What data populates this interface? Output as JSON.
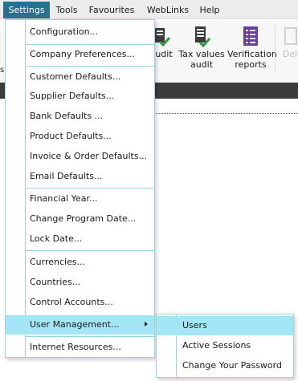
{
  "menubar": {
    "items": [
      {
        "label": "Settings",
        "active": true
      },
      {
        "label": "Tools"
      },
      {
        "label": "Favourites"
      },
      {
        "label": "WebLinks"
      },
      {
        "label": "Help"
      }
    ]
  },
  "ribbon": {
    "buttons": [
      {
        "label": "udit",
        "icon": "audit-icon"
      },
      {
        "label": "Tax values audit",
        "line1": "Tax values",
        "line2": "audit",
        "icon": "tax-audit-icon"
      },
      {
        "label": "Verification reports",
        "line1": "Verification",
        "line2": "reports",
        "icon": "verification-reports-icon"
      },
      {
        "label": "Del",
        "icon": "delete-icon"
      }
    ],
    "left_edge_text": "s"
  },
  "settings_menu": {
    "items": [
      {
        "label": "Configuration..."
      },
      {
        "label": "Company Preferences..."
      },
      {
        "label": "Customer Defaults..."
      },
      {
        "label": "Supplier Defaults..."
      },
      {
        "label": "Bank Defaults ..."
      },
      {
        "label": "Product Defaults..."
      },
      {
        "label": "Invoice & Order Defaults..."
      },
      {
        "label": "Email Defaults..."
      },
      {
        "label": "Financial Year..."
      },
      {
        "label": "Change Program Date..."
      },
      {
        "label": "Lock Date..."
      },
      {
        "label": "Currencies..."
      },
      {
        "label": "Countries..."
      },
      {
        "label": "Control Accounts..."
      },
      {
        "label": "User Management...",
        "has_submenu": true,
        "highlighted": true
      },
      {
        "label": "Internet Resources..."
      }
    ]
  },
  "user_management_submenu": {
    "items": [
      {
        "label": "Users",
        "highlighted": true
      },
      {
        "label": "Active Sessions"
      },
      {
        "label": "Change Your Password"
      }
    ]
  },
  "colors": {
    "menubar_active": "#2b6f8e",
    "highlight": "#a4e6f6",
    "menu_border": "#9bd3df",
    "icon_purple": "#6a3fa0",
    "icon_green": "#2e9a3c",
    "dark_bar": "#3c3c3c"
  }
}
